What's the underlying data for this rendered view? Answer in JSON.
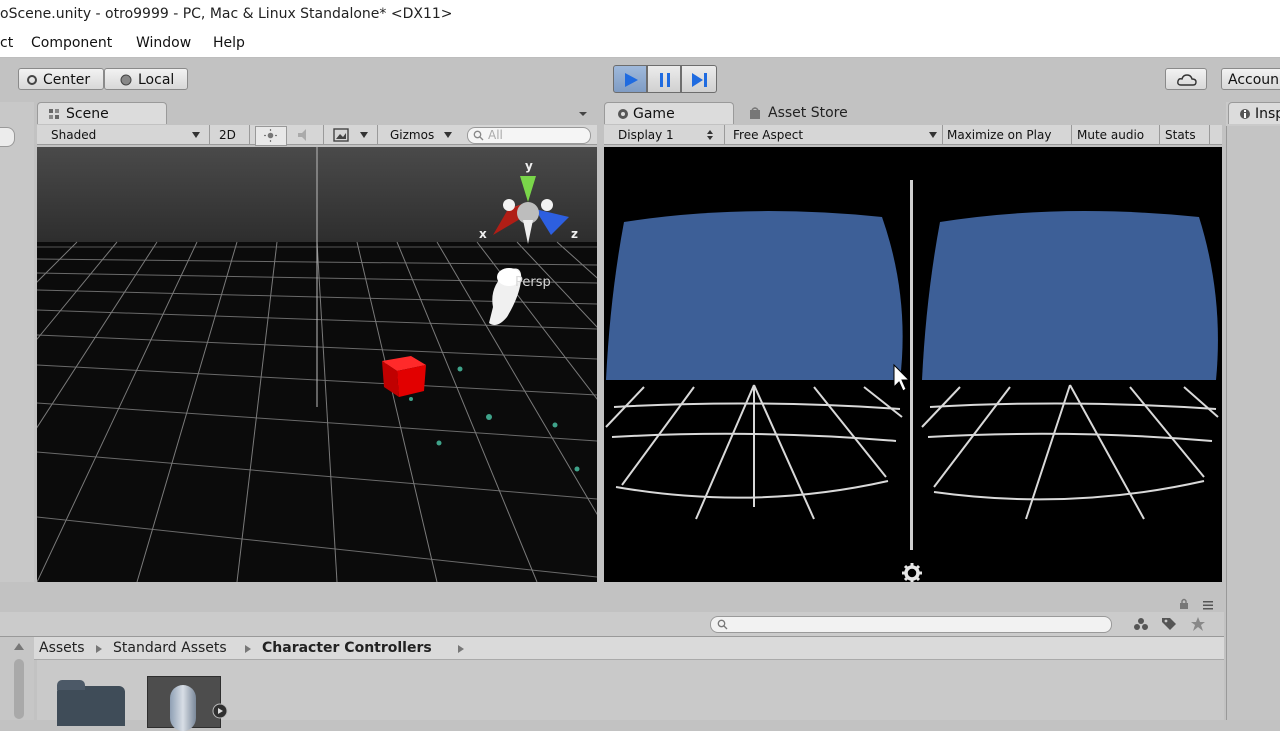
{
  "window": {
    "title": "oScene.unity - otro9999 - PC, Mac & Linux Standalone* <DX11>"
  },
  "menu": {
    "items": [
      "ct",
      "Component",
      "Window",
      "Help"
    ]
  },
  "toolbar": {
    "center_label": "Center",
    "local_label": "Local",
    "account_label": "Accoun"
  },
  "scene": {
    "tab_label": "Scene",
    "shading_mode": "Shaded",
    "mode_2d": "2D",
    "gizmos_label": "Gizmos",
    "search_placeholder": "All",
    "gizmo_axes": {
      "y": "y",
      "x": "x",
      "z": "z"
    },
    "persp_label": "Persp"
  },
  "game": {
    "tab_label": "Game",
    "asset_store_label": "Asset Store",
    "display": "Display 1",
    "aspect": "Free Aspect",
    "maximize_label": "Maximize on Play",
    "mute_label": "Mute audio",
    "stats_label": "Stats",
    "sky_color": "#3d5f97"
  },
  "inspector": {
    "tab_label": "Insp"
  },
  "project": {
    "breadcrumb": [
      "Assets",
      "Standard Assets",
      "Character Controllers"
    ]
  },
  "icons": {
    "play": "play-icon",
    "pause": "pause-icon",
    "step": "step-icon",
    "cloud": "cloud-icon",
    "settings": "gear-icon"
  }
}
